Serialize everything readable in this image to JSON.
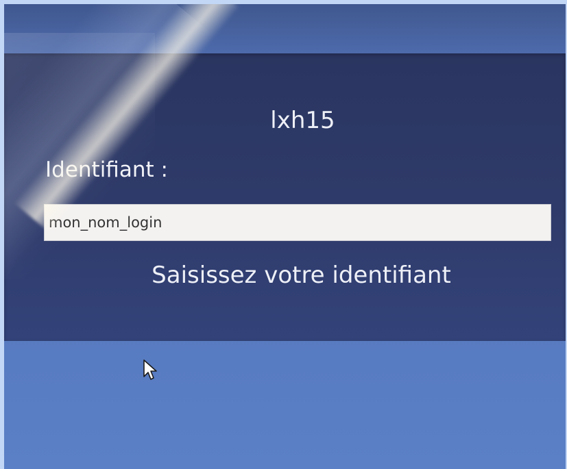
{
  "login": {
    "hostname": "lxh15",
    "field_label": "Identifiant :",
    "field_value": "mon_nom_login",
    "hint": "Saisissez votre identifiant"
  },
  "colors": {
    "panel": "#2f3b6b",
    "background": "#5b80c6",
    "input_bg": "#f4f2f1",
    "text": "#eef0f7"
  },
  "icons": {
    "pointer": "mouse-pointer-icon"
  }
}
